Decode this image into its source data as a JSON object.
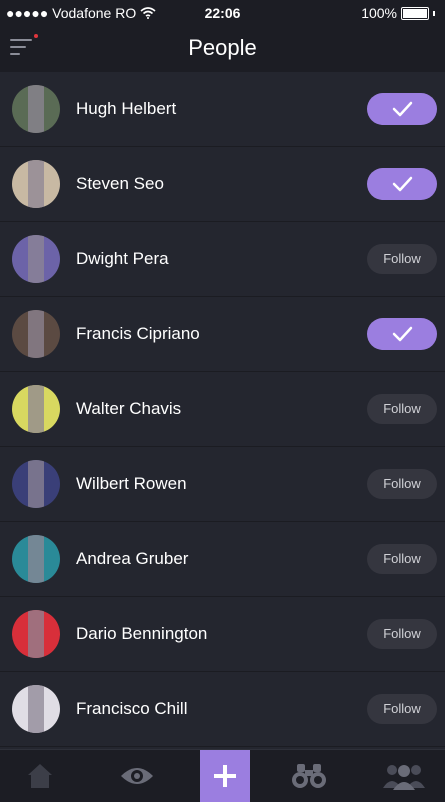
{
  "status_bar": {
    "carrier": "●●●●● Vodafone RO",
    "time": "22:06",
    "battery": "100%"
  },
  "nav": {
    "title": "People"
  },
  "people": [
    {
      "name": "Hugh Helbert",
      "following": true,
      "avatar_color": "#5a6b55"
    },
    {
      "name": "Steven Seo",
      "following": true,
      "avatar_color": "#c8b9a3"
    },
    {
      "name": "Dwight Pera",
      "following": false,
      "follow_label": "Follow",
      "avatar_color": "#6c63a8"
    },
    {
      "name": "Francis Cipriano",
      "following": true,
      "avatar_color": "#5b4a42"
    },
    {
      "name": "Walter Chavis",
      "following": false,
      "follow_label": "Follow",
      "avatar_color": "#d8d860"
    },
    {
      "name": "Wilbert Rowen",
      "following": false,
      "follow_label": "Follow",
      "avatar_color": "#3a3f78"
    },
    {
      "name": "Andrea Gruber",
      "following": false,
      "follow_label": "Follow",
      "avatar_color": "#2a8a98"
    },
    {
      "name": "Dario Bennington",
      "following": false,
      "follow_label": "Follow",
      "avatar_color": "#d82f3a"
    },
    {
      "name": "Francisco Chill",
      "following": false,
      "follow_label": "Follow",
      "avatar_color": "#e0dde5"
    }
  ],
  "tabs": [
    {
      "icon": "home-icon"
    },
    {
      "icon": "eye-icon"
    },
    {
      "icon": "add-icon"
    },
    {
      "icon": "binoculars-icon"
    },
    {
      "icon": "people-icon"
    }
  ],
  "colors": {
    "accent": "#9b7ee0",
    "background": "#24262f",
    "bar": "#1c1d24"
  }
}
